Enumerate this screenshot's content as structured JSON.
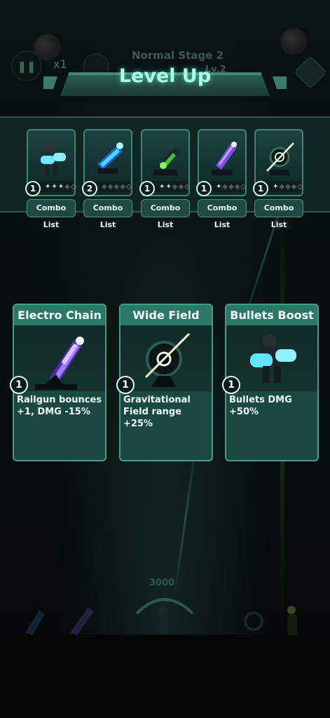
{
  "hud": {
    "pause_icon": "pause-icon",
    "speed_label": "x1",
    "stage_name": "Normal Stage 2",
    "stage_level": "Lv.2",
    "background_score": "3000"
  },
  "banner": {
    "title": "Level Up"
  },
  "weapons": [
    {
      "name": "bullets-turret",
      "level": "1",
      "stars_on": 3,
      "combo_label": "Combo List"
    },
    {
      "name": "railgun-blue",
      "level": "2",
      "stars_on": 0,
      "combo_label": "Combo List"
    },
    {
      "name": "green-cannon",
      "level": "1",
      "stars_on": 2,
      "combo_label": "Combo List"
    },
    {
      "name": "electro-railgun",
      "level": "1",
      "stars_on": 1,
      "combo_label": "Combo List"
    },
    {
      "name": "gravity-field",
      "level": "1",
      "stars_on": 1,
      "combo_label": "Combo List"
    }
  ],
  "choices": [
    {
      "title": "Electro Chain",
      "level": "1",
      "description": "Railgun bounces\n+1, DMG -15%"
    },
    {
      "title": "Wide Field",
      "level": "1",
      "description": "Gravitational\nField range +25%"
    },
    {
      "title": "Bullets Boost",
      "level": "1",
      "description": "Bullets DMG\n+50%"
    }
  ],
  "colors": {
    "accent": "#a9ffe6",
    "card_bg": "#1b4942",
    "card_header": "#2c7867",
    "border": "#4a9b88"
  }
}
